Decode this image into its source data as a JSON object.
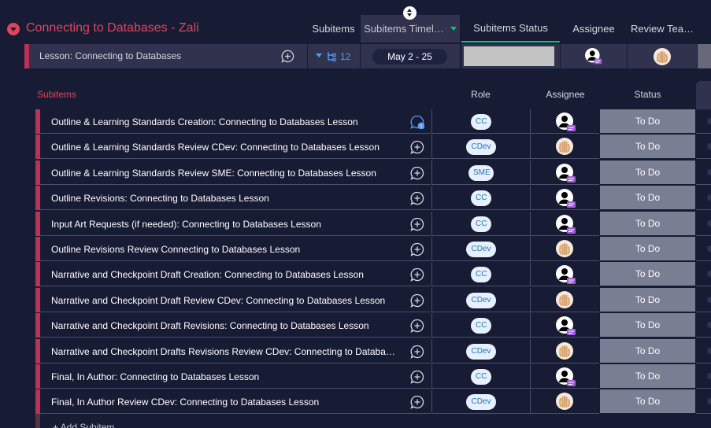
{
  "group": {
    "title": "Connecting to Databases - Zali",
    "accent_color": "#e2445c"
  },
  "columns": {
    "subitems": "Subitems",
    "subitems_timeline": "Subitems Timel…",
    "subitems_status": "Subitems Status",
    "assignee": "Assignee",
    "review_team": "Review Tea…"
  },
  "parent_item": {
    "name": "Lesson: Connecting to Databases",
    "subitem_count": "12",
    "timeline": "May 2 - 25",
    "status_color": "#c4c4c4"
  },
  "subitems_table": {
    "title": "Subitems",
    "headers": {
      "role": "Role",
      "assignee": "Assignee",
      "status": "Status"
    },
    "add_label": "+ Add Subitem",
    "rows": [
      {
        "name": "Outline & Learning Standards Creation: Connecting to Databases Lesson",
        "role": "CC",
        "assignee_type": "person-icon",
        "status": "To Do",
        "updates": "1"
      },
      {
        "name": "Outline & Learning Standards Review CDev: Connecting to Databases Lesson",
        "role": "CDev",
        "assignee_type": "hand-photo",
        "status": "To Do"
      },
      {
        "name": "Outline & Learning Standards Review SME: Connecting to Databases Lesson",
        "role": "SME",
        "assignee_type": "person-icon",
        "status": "To Do"
      },
      {
        "name": "Outline Revisions: Connecting to Databases Lesson",
        "role": "CC",
        "assignee_type": "person-icon",
        "status": "To Do"
      },
      {
        "name": "Input Art Requests (if needed): Connecting to Databases Lesson",
        "role": "CC",
        "assignee_type": "person-icon",
        "status": "To Do"
      },
      {
        "name": "Outline Revisions Review Connecting to Databases Lesson",
        "role": "CDev",
        "assignee_type": "hand-photo",
        "status": "To Do"
      },
      {
        "name": "Narrative and Checkpoint Draft Creation: Connecting to Databases Lesson",
        "role": "CC",
        "assignee_type": "person-icon",
        "status": "To Do"
      },
      {
        "name": "Narrative and Checkpoint Draft Review CDev: Connecting to Databases Lesson",
        "role": "CDev",
        "assignee_type": "hand-photo",
        "status": "To Do"
      },
      {
        "name": "Narrative and Checkpoint Draft Revisions: Connecting to Databases Lesson",
        "role": "CC",
        "assignee_type": "person-icon",
        "status": "To Do"
      },
      {
        "name": "Narrative and Checkpoint Drafts Revisions Review CDev: Connecting to Databases Lesson",
        "role": "CDev",
        "assignee_type": "hand-photo",
        "status": "To Do"
      },
      {
        "name": "Final, In Author: Connecting to Databases Lesson",
        "role": "CC",
        "assignee_type": "person-icon",
        "status": "To Do"
      },
      {
        "name": "Final, In Author Review CDev: Connecting to Databases Lesson",
        "role": "CDev",
        "assignee_type": "hand-photo",
        "status": "To Do"
      }
    ]
  },
  "colors": {
    "background": "#181b34",
    "row_bg": "#30324e",
    "accent_red": "#bb3354",
    "status_todo": "#797e93",
    "role_pill_bg": "#e6f0ff",
    "role_pill_text": "#1f76c2"
  }
}
